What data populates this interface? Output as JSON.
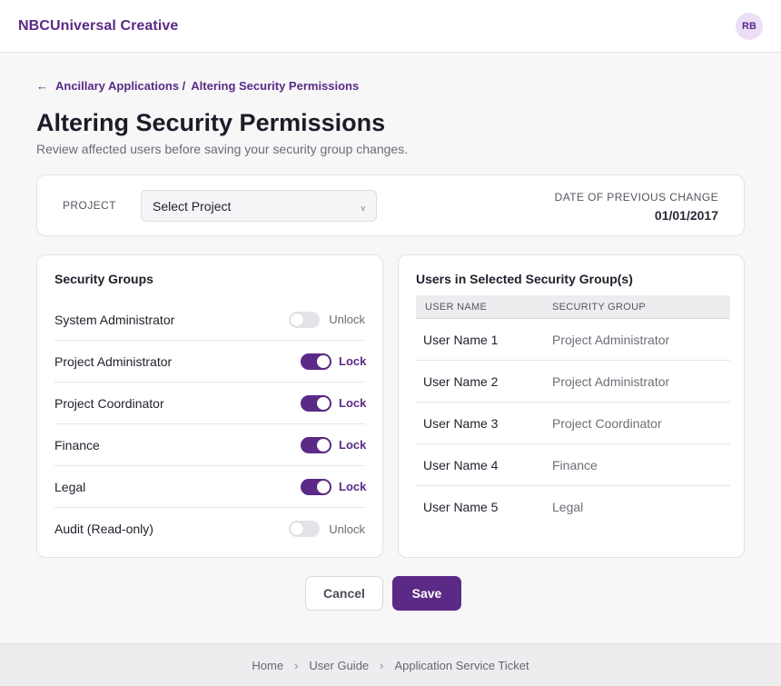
{
  "header": {
    "brand": "NBCUniversal Creative",
    "avatar_initials": "RB"
  },
  "breadcrumb": {
    "parent": "Ancillary Applications /",
    "current": "Altering Security Permissions"
  },
  "page": {
    "title": "Altering Security Permissions",
    "subtitle": "Review affected users before saving your security group changes."
  },
  "project": {
    "label": "PROJECT",
    "select_value": "Select Project",
    "prev_change_label": "DATE OF PREVIOUS CHANGE",
    "prev_change_date": "01/01/2017"
  },
  "security_groups": {
    "title": "Security Groups",
    "items": [
      {
        "name": "System Administrator",
        "state": "Unlock",
        "locked": false
      },
      {
        "name": "Project Administrator",
        "state": "Lock",
        "locked": true
      },
      {
        "name": "Project Coordinator",
        "state": "Lock",
        "locked": true
      },
      {
        "name": "Finance",
        "state": "Lock",
        "locked": true
      },
      {
        "name": "Legal",
        "state": "Lock",
        "locked": true
      },
      {
        "name": "Audit (Read-only)",
        "state": "Unlock",
        "locked": false
      }
    ]
  },
  "users": {
    "title": "Users in Selected Security Group(s)",
    "columns": [
      "USER NAME",
      "SECURITY GROUP"
    ],
    "rows": [
      {
        "user": "User Name 1",
        "group": "Project Administrator"
      },
      {
        "user": "User Name 2",
        "group": "Project Administrator"
      },
      {
        "user": "User Name 3",
        "group": "Project Coordinator"
      },
      {
        "user": "User Name 4",
        "group": "Finance"
      },
      {
        "user": "User Name 5",
        "group": "Legal"
      }
    ]
  },
  "actions": {
    "cancel_label": "Cancel",
    "save_label": "Save"
  },
  "footer": {
    "links": [
      "Home",
      "User Guide",
      "Application Service Ticket"
    ],
    "separator": "›"
  },
  "colors": {
    "accent": "#5b2a86",
    "background": "#f7f7f8"
  },
  "icons": {
    "back": "arrow-left-icon",
    "select": "chevron-down-icon"
  }
}
